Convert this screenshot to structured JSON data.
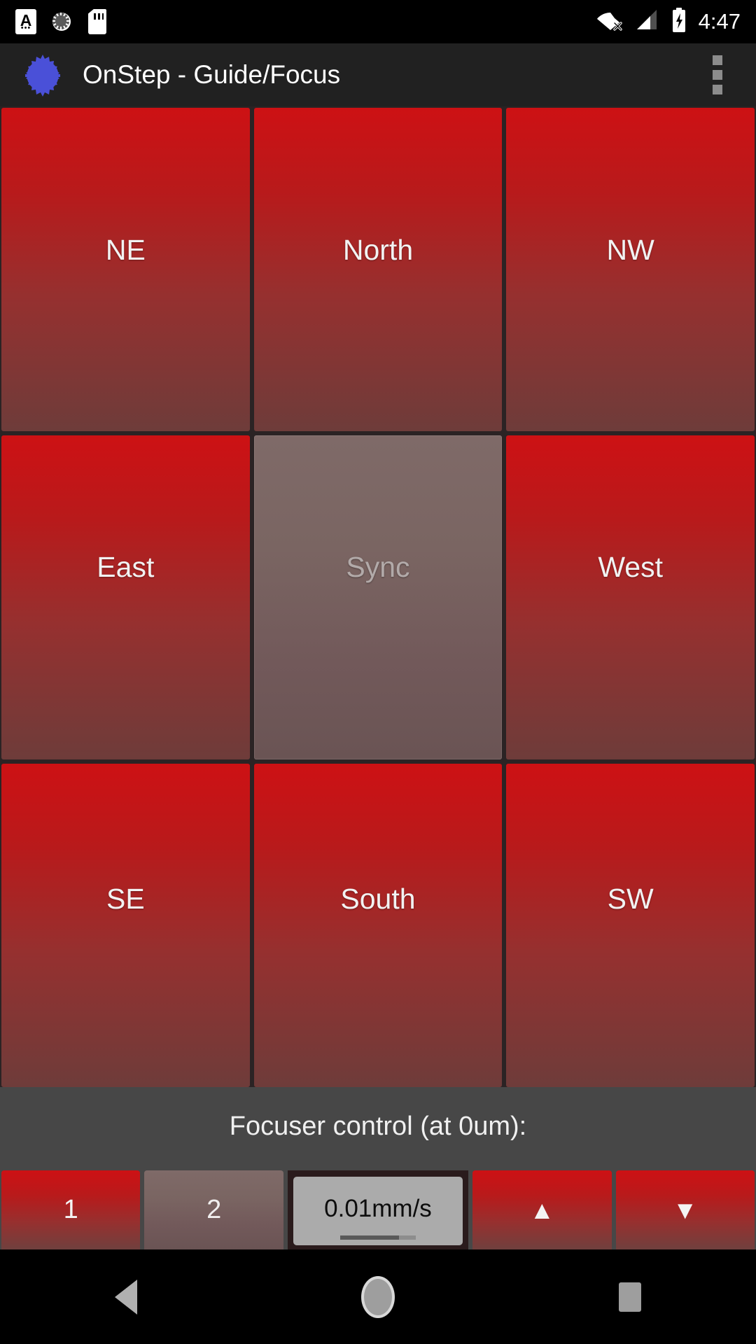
{
  "status_bar": {
    "icons_left": [
      {
        "name": "font-size-a-icon",
        "glyph": "A"
      },
      {
        "name": "sync-spinner-icon",
        "glyph": "◌"
      },
      {
        "name": "sd-card-icon",
        "glyph": "▯"
      }
    ],
    "icons_right": [
      {
        "name": "wifi-disconnected-icon",
        "glyph": "wifi-x"
      },
      {
        "name": "cellular-signal-icon",
        "glyph": "signal"
      },
      {
        "name": "battery-charging-icon",
        "glyph": "battery"
      }
    ],
    "time": "4:47"
  },
  "app_bar": {
    "logo_name": "onstep-telescope-gear-icon",
    "title": "OnStep - Guide/Focus",
    "overflow_label": "More options"
  },
  "direction_grid": {
    "buttons": [
      {
        "label": "NE",
        "name": "direction-button-ne",
        "enabled": true
      },
      {
        "label": "North",
        "name": "direction-button-north",
        "enabled": true
      },
      {
        "label": "NW",
        "name": "direction-button-nw",
        "enabled": true
      },
      {
        "label": "East",
        "name": "direction-button-east",
        "enabled": true
      },
      {
        "label": "Sync",
        "name": "sync-button",
        "enabled": false
      },
      {
        "label": "West",
        "name": "direction-button-west",
        "enabled": true
      },
      {
        "label": "SE",
        "name": "direction-button-se",
        "enabled": true
      },
      {
        "label": "South",
        "name": "direction-button-south",
        "enabled": true
      },
      {
        "label": "SW",
        "name": "direction-button-sw",
        "enabled": true
      }
    ]
  },
  "focuser": {
    "title": "Focuser control (at 0um):",
    "position_um": 0,
    "select_1_label": "1",
    "select_2_label": "2",
    "selected_focuser": "2",
    "speed_value": "0.01mm/s",
    "move_in_glyph": "▲",
    "move_out_glyph": "▼"
  },
  "nav_bar": {
    "back_label": "Back",
    "home_label": "Home",
    "recents_label": "Recent apps"
  },
  "colors": {
    "button_red_top": "#cd1114",
    "button_red_bottom": "#6e3c3a",
    "disabled_mauve": "#7a6562",
    "app_bar_bg": "#212121",
    "focuser_panel_bg": "#474747",
    "logo_blue": "#4a50d8",
    "spinner_bg": "#ababab"
  }
}
